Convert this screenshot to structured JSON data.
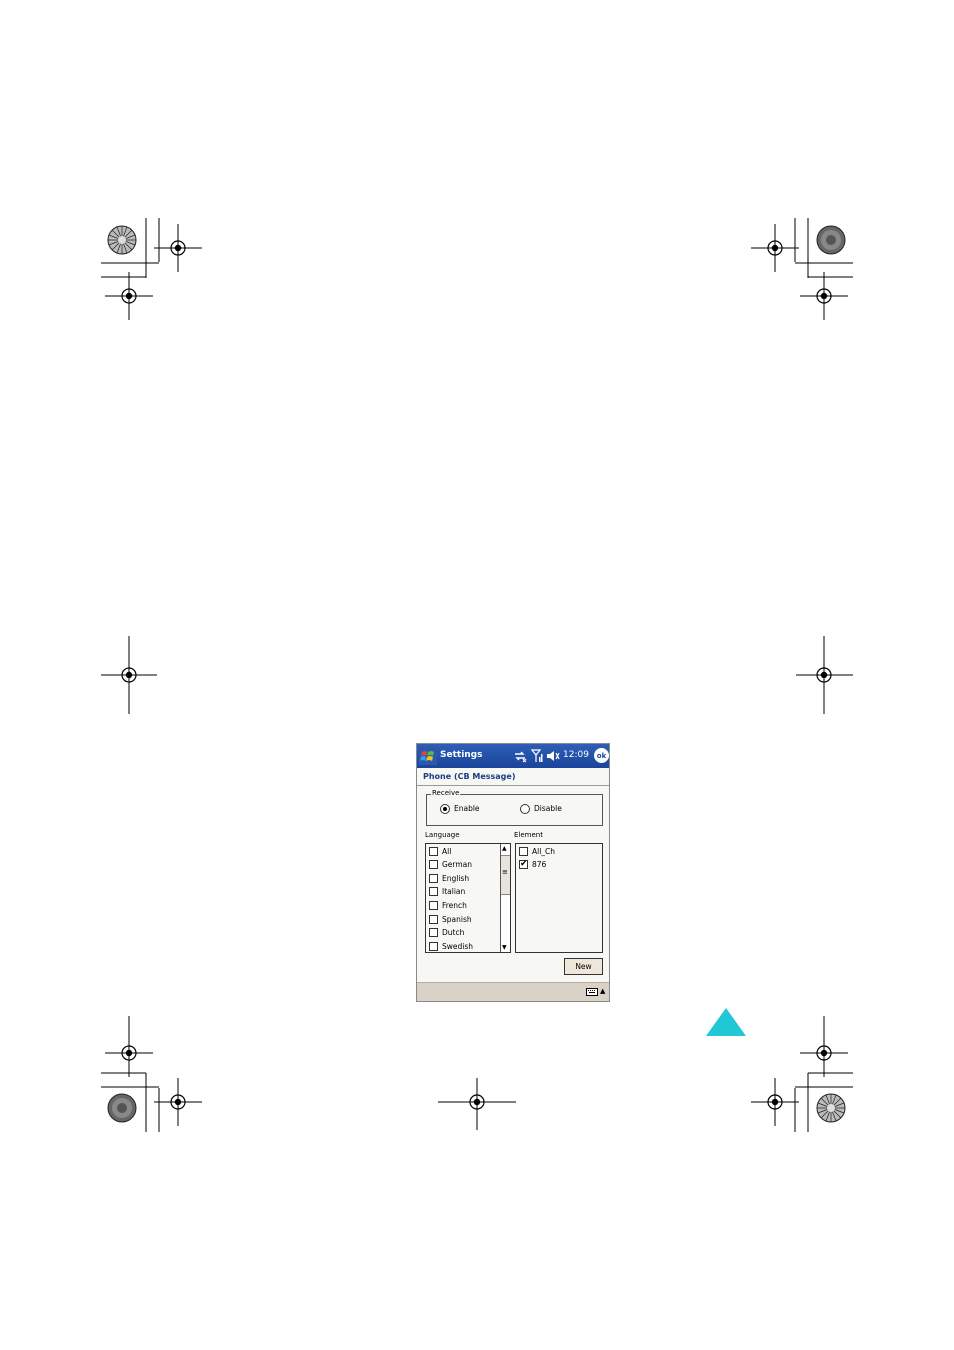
{
  "titlebar": {
    "title": "Settings",
    "clock": "12:09",
    "ok_label": "ok",
    "icons": [
      "windows-start-icon",
      "sync-icon",
      "signal-icon",
      "speaker-icon"
    ]
  },
  "page_title": "Phone (CB Message)",
  "receive": {
    "legend": "Receive",
    "options": [
      {
        "label": "Enable",
        "selected": true
      },
      {
        "label": "Disable",
        "selected": false
      }
    ]
  },
  "language": {
    "label": "Language",
    "items": [
      {
        "label": "All",
        "checked": false
      },
      {
        "label": "German",
        "checked": false
      },
      {
        "label": "English",
        "checked": false
      },
      {
        "label": "Italian",
        "checked": false
      },
      {
        "label": "French",
        "checked": false
      },
      {
        "label": "Spanish",
        "checked": false
      },
      {
        "label": "Dutch",
        "checked": false
      },
      {
        "label": "Swedish",
        "checked": false
      }
    ]
  },
  "element": {
    "label": "Element",
    "items": [
      {
        "label": "All_Ch",
        "checked": false
      },
      {
        "label": "876",
        "checked": true
      }
    ]
  },
  "buttons": {
    "new_label": "New"
  },
  "taskbar": {
    "icons": [
      "keyboard-icon",
      "sip-arrow-icon"
    ]
  },
  "colors": {
    "titlebar": "#1b449a",
    "page_title": "#1b3d86",
    "taskbar": "#dad2c7",
    "triangle": "#22c7d6"
  }
}
